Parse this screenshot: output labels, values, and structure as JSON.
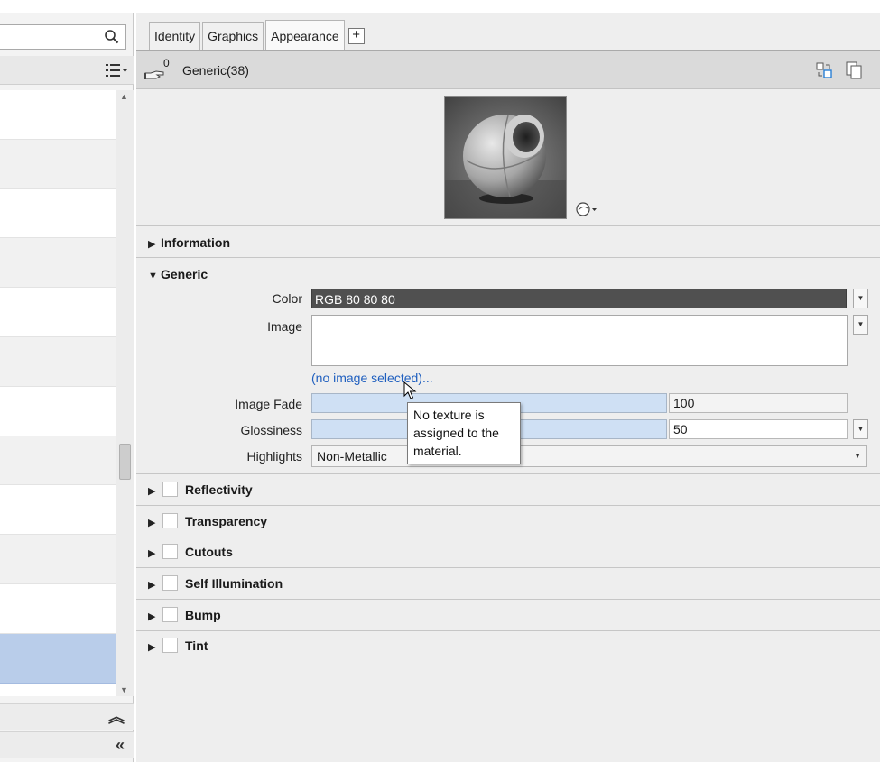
{
  "left_panel": {
    "search": {
      "placeholder": ""
    },
    "rows": [
      "",
      "",
      "",
      "",
      "",
      "",
      "",
      "",
      "",
      "",
      "",
      ""
    ]
  },
  "tabs": [
    {
      "label": "Identity"
    },
    {
      "label": "Graphics"
    },
    {
      "label": "Appearance"
    }
  ],
  "add_tab_label": "+",
  "material": {
    "usage_count": "0",
    "name": "Generic(38)"
  },
  "sections": {
    "information": "Information",
    "generic": "Generic",
    "reflectivity": "Reflectivity",
    "transparency": "Transparency",
    "cutouts": "Cutouts",
    "self_illumination": "Self Illumination",
    "bump": "Bump",
    "tint": "Tint"
  },
  "generic": {
    "color_label": "Color",
    "color_value": "RGB 80 80 80",
    "image_label": "Image",
    "no_image_link": "(no image selected)...",
    "image_fade_label": "Image Fade",
    "image_fade_value": "100",
    "glossiness_label": "Glossiness",
    "glossiness_value": "50",
    "highlights_label": "Highlights",
    "highlights_value": "Non-Metallic"
  },
  "tooltip": {
    "line1": "No texture is",
    "line2": "assigned to the",
    "line3": "material."
  },
  "colors": {
    "color_swatch": "#505050",
    "link": "#1f5fbf",
    "selected_row": "#b9cdea",
    "slider_fill": "#cfe0f4"
  }
}
